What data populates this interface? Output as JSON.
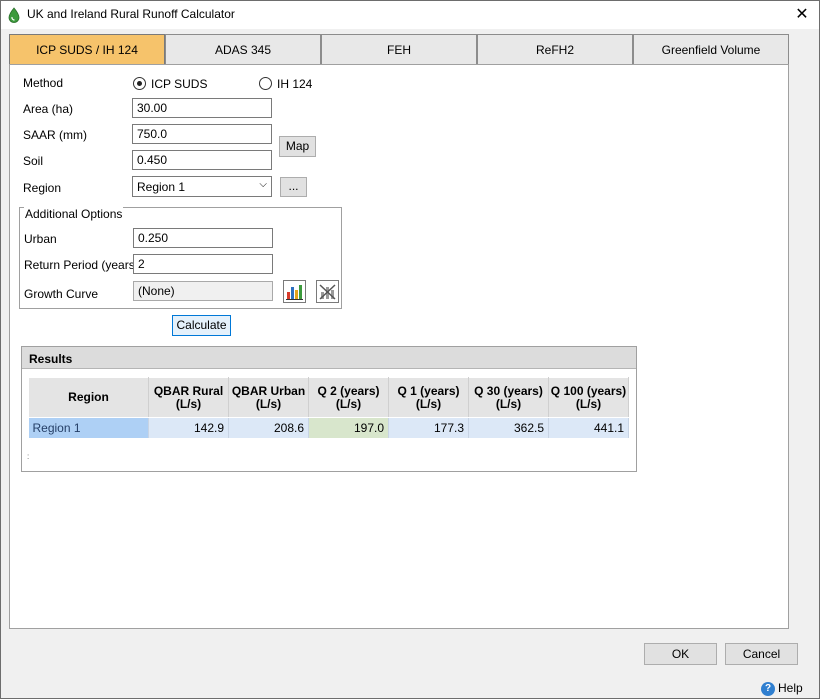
{
  "window": {
    "title": "UK and Ireland Rural Runoff Calculator",
    "close_glyph": "✕"
  },
  "tabs": [
    {
      "label": "ICP SUDS / IH 124",
      "active": true
    },
    {
      "label": "ADAS 345"
    },
    {
      "label": "FEH"
    },
    {
      "label": "ReFH2"
    },
    {
      "label": "Greenfield Volume"
    }
  ],
  "form": {
    "method_label": "Method",
    "method_options": [
      "ICP SUDS",
      "IH 124"
    ],
    "method_selected": "ICP SUDS",
    "area_label": "Area (ha)",
    "area_value": "30.00",
    "saar_label": "SAAR (mm)",
    "saar_value": "750.0",
    "map_button": "Map",
    "soil_label": "Soil",
    "soil_value": "0.450",
    "region_label": "Region",
    "region_value": "Region 1",
    "region_more_button": "...",
    "additional_options_title": "Additional Options",
    "urban_label": "Urban",
    "urban_value": "0.250",
    "return_period_label": "Return Period (years)",
    "return_period_value": "2",
    "growth_curve_label": "Growth Curve",
    "growth_curve_value": "(None)",
    "calculate_button": "Calculate"
  },
  "results": {
    "title": "Results",
    "columns": [
      {
        "line1": "Region",
        "line2": ""
      },
      {
        "line1": "QBAR Rural",
        "line2": "(L/s)"
      },
      {
        "line1": "QBAR Urban",
        "line2": "(L/s)"
      },
      {
        "line1": "Q 2 (years)",
        "line2": "(L/s)"
      },
      {
        "line1": "Q 1 (years)",
        "line2": "(L/s)"
      },
      {
        "line1": "Q 30 (years)",
        "line2": "(L/s)"
      },
      {
        "line1": "Q 100 (years)",
        "line2": "(L/s)"
      }
    ],
    "rows": [
      [
        "Region 1",
        "142.9",
        "208.6",
        "197.0",
        "177.3",
        "362.5",
        "441.1"
      ]
    ],
    "footnote": ":"
  },
  "footer": {
    "ok_button": "OK",
    "cancel_button": "Cancel",
    "help_label": "Help",
    "help_glyph": "?"
  },
  "colors": {
    "active_tab": "#f6c36b",
    "selected_region_cell": "#aed0f5",
    "highlight_cell": "#d8e6cc"
  }
}
